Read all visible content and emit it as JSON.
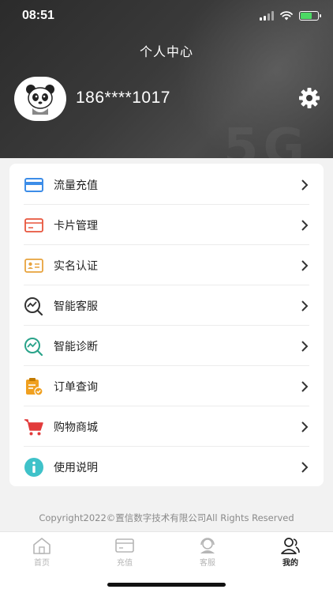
{
  "status_bar": {
    "time": "08:51"
  },
  "header": {
    "title": "个人中心",
    "phone": "186****1017",
    "watermark": "5G"
  },
  "menu": [
    {
      "label": "流量充值",
      "icon": "card-recharge-icon",
      "color": "#3d8de8"
    },
    {
      "label": "卡片管理",
      "icon": "card-manage-icon",
      "color": "#e8553d"
    },
    {
      "label": "实名认证",
      "icon": "id-card-icon",
      "color": "#e8a33d"
    },
    {
      "label": "智能客服",
      "icon": "chat-search-icon",
      "color": "#333333"
    },
    {
      "label": "智能诊断",
      "icon": "diagnose-icon",
      "color": "#2aa38a"
    },
    {
      "label": "订单查询",
      "icon": "order-clipboard-icon",
      "color": "#f0a020"
    },
    {
      "label": "购物商城",
      "icon": "cart-icon",
      "color": "#e23b3b"
    },
    {
      "label": "使用说明",
      "icon": "info-icon",
      "color": "#3fc2c9"
    }
  ],
  "copyright": "Copyright2022©置信数字技术有限公司All Rights Reserved",
  "tabbar": [
    {
      "label": "首页",
      "icon": "home-icon",
      "active": false
    },
    {
      "label": "充值",
      "icon": "card-icon",
      "active": false
    },
    {
      "label": "客服",
      "icon": "service-icon",
      "active": false
    },
    {
      "label": "我的",
      "icon": "user-icon",
      "active": true
    }
  ]
}
